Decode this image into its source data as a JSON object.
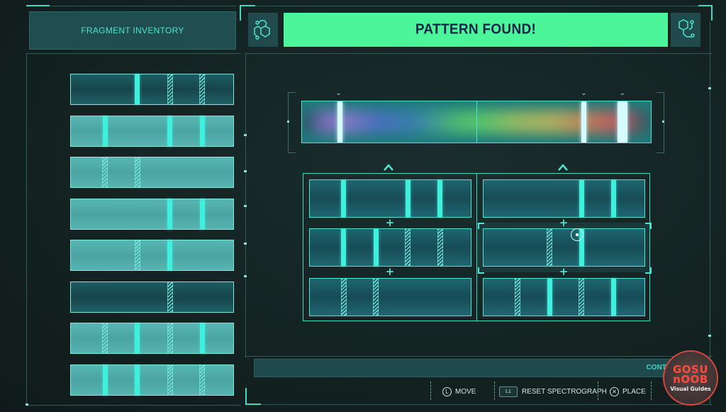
{
  "inventory": {
    "title": "FRAGMENT INVENTORY",
    "fragments": [
      {
        "tone": "dark",
        "markers": [
          {
            "slot": 2,
            "type": "solid"
          },
          {
            "slot": 3,
            "type": "hatch"
          },
          {
            "slot": 4,
            "type": "hatch"
          }
        ]
      },
      {
        "tone": "light",
        "markers": [
          {
            "slot": 1,
            "type": "solid"
          },
          {
            "slot": 3,
            "type": "solid"
          },
          {
            "slot": 4,
            "type": "solid"
          }
        ]
      },
      {
        "tone": "light",
        "markers": [
          {
            "slot": 1,
            "type": "hatch"
          },
          {
            "slot": 2,
            "type": "hatch"
          }
        ]
      },
      {
        "tone": "light",
        "markers": [
          {
            "slot": 3,
            "type": "solid"
          },
          {
            "slot": 4,
            "type": "solid"
          }
        ]
      },
      {
        "tone": "light",
        "markers": [
          {
            "slot": 2,
            "type": "hatch"
          },
          {
            "slot": 3,
            "type": "solid"
          }
        ]
      },
      {
        "tone": "dark",
        "markers": [
          {
            "slot": 3,
            "type": "hatch"
          }
        ]
      },
      {
        "tone": "light",
        "markers": [
          {
            "slot": 1,
            "type": "hatch"
          },
          {
            "slot": 2,
            "type": "solid"
          },
          {
            "slot": 3,
            "type": "hatch"
          },
          {
            "slot": 4,
            "type": "solid"
          }
        ]
      },
      {
        "tone": "light",
        "markers": [
          {
            "slot": 1,
            "type": "solid"
          },
          {
            "slot": 2,
            "type": "solid"
          },
          {
            "slot": 3,
            "type": "hatch"
          },
          {
            "slot": 4,
            "type": "hatch"
          }
        ]
      }
    ]
  },
  "header": {
    "status": "PATTERN FOUND!",
    "left_icon": "molecule-icon",
    "right_icon": "molecule-icon",
    "status_color": "#4cf59a"
  },
  "spectrograph": {
    "markers": [
      {
        "position": 0.108,
        "wide": false
      },
      {
        "position": 0.808,
        "wide": false
      },
      {
        "position": 0.918,
        "wide": true
      }
    ]
  },
  "pattern_grid": {
    "columns": [
      {
        "rows": [
          {
            "markers": [
              {
                "slot": 1,
                "type": "solid"
              },
              {
                "slot": 3,
                "type": "solid"
              },
              {
                "slot": 4,
                "type": "solid"
              }
            ]
          },
          {
            "markers": [
              {
                "slot": 1,
                "type": "solid"
              },
              {
                "slot": 2,
                "type": "solid"
              },
              {
                "slot": 3,
                "type": "hatch"
              },
              {
                "slot": 4,
                "type": "hatch"
              }
            ]
          },
          {
            "markers": [
              {
                "slot": 1,
                "type": "hatch"
              },
              {
                "slot": 2,
                "type": "hatch"
              }
            ]
          }
        ]
      },
      {
        "selected_row": 1,
        "rows": [
          {
            "markers": [
              {
                "slot": 3,
                "type": "solid"
              },
              {
                "slot": 4,
                "type": "solid"
              }
            ]
          },
          {
            "markers": [
              {
                "slot": 2,
                "type": "hatch"
              },
              {
                "slot": 3,
                "type": "solid"
              }
            ]
          },
          {
            "markers": [
              {
                "slot": 1,
                "type": "hatch"
              },
              {
                "slot": 2,
                "type": "solid"
              },
              {
                "slot": 3,
                "type": "hatch"
              },
              {
                "slot": 4,
                "type": "solid"
              }
            ]
          }
        ]
      }
    ],
    "plus_symbol": "+"
  },
  "footer": {
    "controls_label": "CONTR",
    "hints": [
      {
        "button": "L",
        "label": "MOVE"
      },
      {
        "button": "L1",
        "label": "RESET SPECTROGRAPH"
      },
      {
        "button": "✕",
        "label": "PLACE"
      }
    ]
  },
  "watermark": {
    "line1": "GOSU",
    "line2": "nOOB",
    "line3": "Visual Guides"
  }
}
